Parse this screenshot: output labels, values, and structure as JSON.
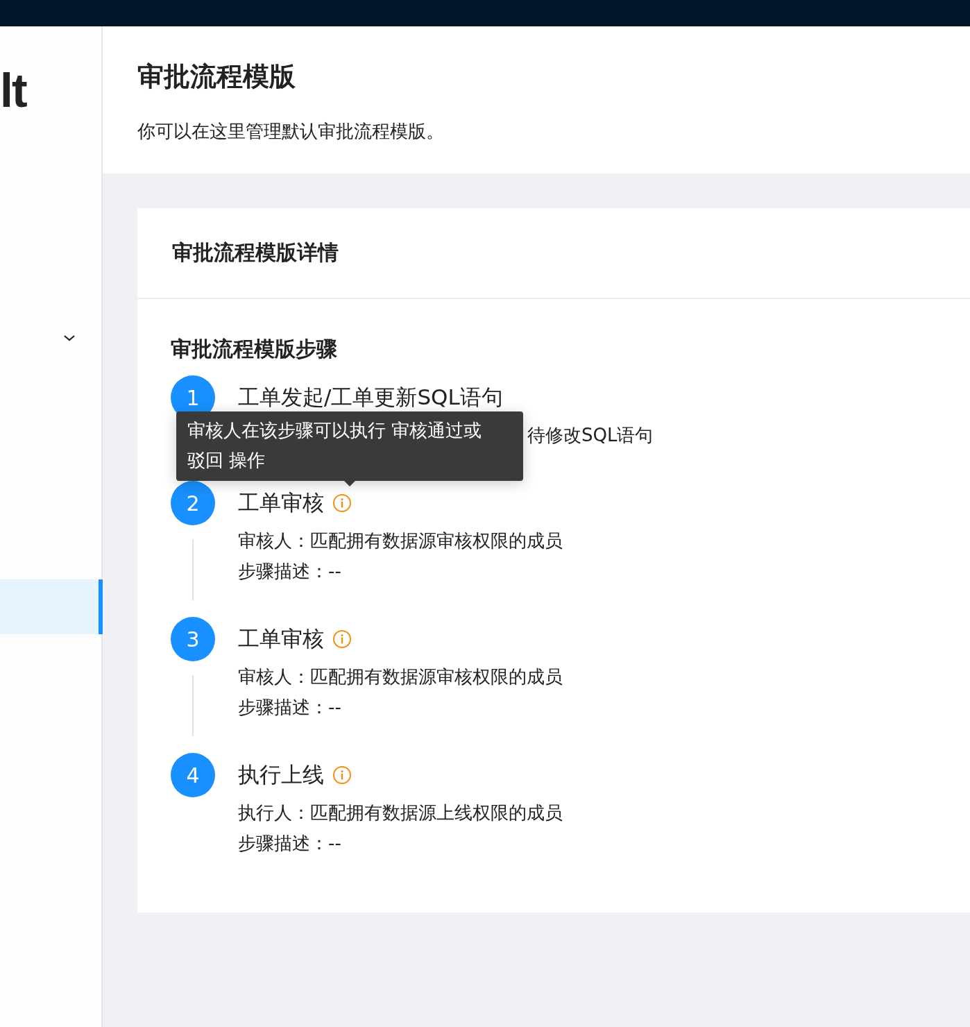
{
  "sidebar": {
    "logo_text": "lt",
    "menu_expanded": false,
    "selected_item": true
  },
  "page": {
    "title": "审批流程模版",
    "description": "你可以在这里管理默认审批流程模版。"
  },
  "card": {
    "title": "审批流程模版详情",
    "section_title": "审批流程模版步骤",
    "steps": [
      {
        "number": "1",
        "title": "工单发起/工单更新SQL语句",
        "info": false,
        "covered": true,
        "lines": [
          "待修改SQL语句"
        ]
      },
      {
        "number": "2",
        "title": "工单审核",
        "info": true,
        "lines": [
          "审核人：匹配拥有数据源审核权限的成员",
          "步骤描述：--"
        ]
      },
      {
        "number": "3",
        "title": "工单审核",
        "info": true,
        "lines": [
          "审核人：匹配拥有数据源审核权限的成员",
          "步骤描述：--"
        ]
      },
      {
        "number": "4",
        "title": "执行上线",
        "info": true,
        "lines": [
          "执行人：匹配拥有数据源上线权限的成员",
          "步骤描述：--"
        ]
      }
    ]
  },
  "tooltip": {
    "text": "审核人在该步骤可以执行 审核通过或驳回 操作"
  }
}
